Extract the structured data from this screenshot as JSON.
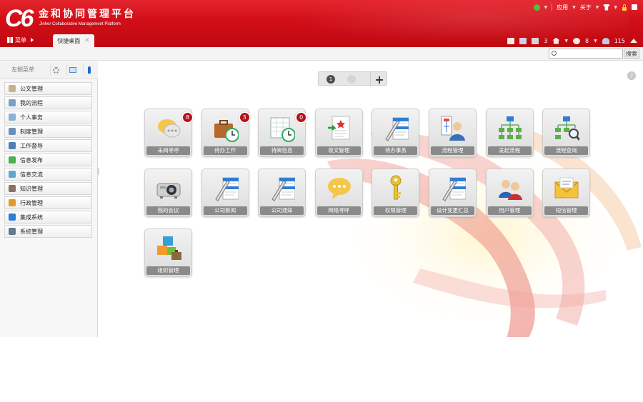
{
  "app": {
    "logo_mark": "C6",
    "title_cn": "金和协同管理平台",
    "title_en": "Jinher Collaborative Management Platform"
  },
  "top_links": {
    "apps": "应用",
    "about": "关于"
  },
  "menubar": {
    "menu_label": "菜单",
    "active_tab": "快捷桌面",
    "tab_close": "✕"
  },
  "header_counts": {
    "docs": "3",
    "chat": "8",
    "online": "115"
  },
  "search": {
    "placeholder": "",
    "button": "搜索"
  },
  "sidebar": {
    "title": "左侧菜单",
    "items": [
      {
        "label": "公文管理",
        "color": "#c8b18a"
      },
      {
        "label": "我的流程",
        "color": "#7aa0c8"
      },
      {
        "label": "个人事务",
        "color": "#8ab0d8"
      },
      {
        "label": "制度管理",
        "color": "#6a8fb8"
      },
      {
        "label": "工作督导",
        "color": "#4f7fb3"
      },
      {
        "label": "信息发布",
        "color": "#4caf50"
      },
      {
        "label": "信息交流",
        "color": "#5fa8d3"
      },
      {
        "label": "知识管理",
        "color": "#8d6e63"
      },
      {
        "label": "行政管理",
        "color": "#e09a2c"
      },
      {
        "label": "集成系统",
        "color": "#2f7fd1"
      },
      {
        "label": "系统管理",
        "color": "#607d8b"
      }
    ]
  },
  "pager": {
    "current": "1",
    "add": "+"
  },
  "help": "?",
  "tiles": [
    {
      "label": "未阅寻呼",
      "badge": "8",
      "icon": "chat-bubbles-icon"
    },
    {
      "label": "待办工作",
      "badge": "3",
      "icon": "briefcase-clock-icon"
    },
    {
      "label": "待阅信息",
      "badge": "0",
      "icon": "calendar-clock-icon"
    },
    {
      "label": "收文管理",
      "badge": "",
      "icon": "incoming-document-icon"
    },
    {
      "label": "待办事务",
      "badge": "",
      "icon": "pen-form-icon"
    },
    {
      "label": "流程管理",
      "badge": "",
      "icon": "user-chart-icon"
    },
    {
      "label": "发起流程",
      "badge": "",
      "icon": "org-chart-icon"
    },
    {
      "label": "流程查询",
      "badge": "",
      "icon": "org-chart-search-icon"
    },
    {
      "label": "我的会议",
      "badge": "",
      "icon": "projector-icon"
    },
    {
      "label": "公司新闻",
      "badge": "",
      "icon": "pen-form-icon"
    },
    {
      "label": "公司通知",
      "badge": "",
      "icon": "pen-form-icon"
    },
    {
      "label": "网络寻呼",
      "badge": "",
      "icon": "speech-bubble-icon"
    },
    {
      "label": "权限管理",
      "badge": "",
      "icon": "key-icon"
    },
    {
      "label": "设计变更汇总",
      "badge": "",
      "icon": "pen-form-icon"
    },
    {
      "label": "用户管理",
      "badge": "",
      "icon": "users-icon"
    },
    {
      "label": "短信管理",
      "badge": "",
      "icon": "envelope-icon"
    },
    {
      "label": "组织管理",
      "badge": "",
      "icon": "blocks-icon"
    }
  ]
}
